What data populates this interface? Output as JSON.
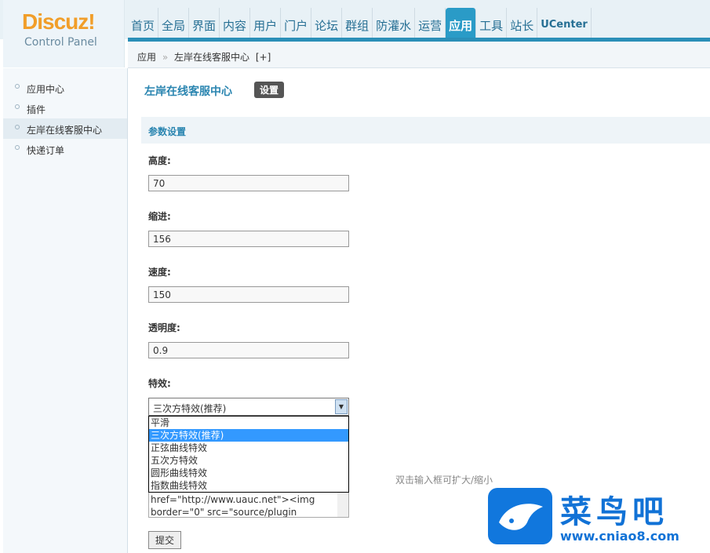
{
  "logo": {
    "brand": "Discuz!",
    "sub": "Control Panel"
  },
  "nav": [
    "首页",
    "全局",
    "界面",
    "内容",
    "用户",
    "门户",
    "论坛",
    "群组",
    "防灌水",
    "运营",
    "应用",
    "工具",
    "站长",
    "UCenter"
  ],
  "nav_active": "应用",
  "breadcrumb": {
    "root": "应用",
    "sep": "»",
    "current": "左岸在线客服中心",
    "add": "[+]"
  },
  "sidebar": [
    {
      "label": "应用中心"
    },
    {
      "label": "插件"
    },
    {
      "label": "左岸在线客服中心",
      "active": true
    },
    {
      "label": "快递订单"
    }
  ],
  "main": {
    "title": "左岸在线客服中心",
    "settings_button": "设置",
    "section": "参数设置",
    "fields": [
      {
        "label": "高度:",
        "value": "70"
      },
      {
        "label": "缩进:",
        "value": "156"
      },
      {
        "label": "速度:",
        "value": "150"
      },
      {
        "label": "透明度:",
        "value": "0.9"
      }
    ],
    "effect_label": "特效:",
    "effect_value": "三次方特效(推荐)",
    "effect_options": [
      "平滑",
      "三次方特效(推荐)",
      "正弦曲线特效",
      "五次方特效",
      "圆形曲线特效",
      "指数曲线特效"
    ],
    "textarea_lines": [
      "href=\"http://www.uauc.net\"><img",
      "border=\"0\" src=\"source/plugin"
    ],
    "hint": "双击输入框可扩大/缩小",
    "submit": "提交"
  },
  "watermark": {
    "name": "菜鸟吧",
    "url": "www.cniao8.com"
  }
}
